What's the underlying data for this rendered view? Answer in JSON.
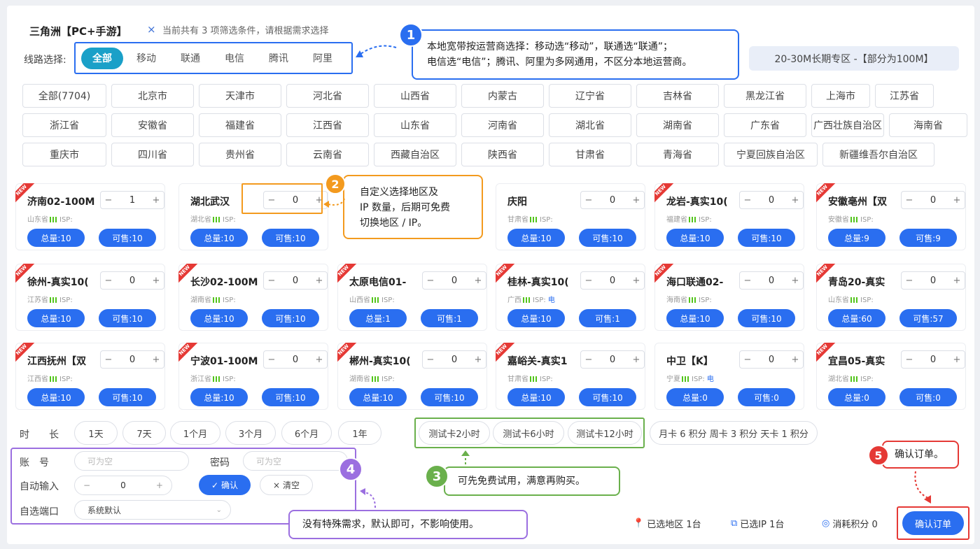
{
  "header": {
    "title": "三角洲【PC+手游】",
    "close": "×",
    "filter_tip": "当前共有 3 项筛选条件，请根据需求选择"
  },
  "line": {
    "label": "线路选择:",
    "options": [
      "全部",
      "移动",
      "联通",
      "电信",
      "腾讯",
      "阿里"
    ]
  },
  "zone": "20-30M长期专区 -【部分为100M】",
  "regions": {
    "row1": [
      "全部(7704)",
      "北京市",
      "天津市",
      "河北省",
      "山西省",
      "内蒙古",
      "辽宁省",
      "吉林省",
      "黑龙江省",
      "上海市",
      "江苏省"
    ],
    "row2": [
      "浙江省",
      "安徽省",
      "福建省",
      "江西省",
      "山东省",
      "河南省",
      "湖北省",
      "湖南省",
      "广东省",
      "广西壮族自治区",
      "海南省"
    ],
    "row3": [
      "重庆市",
      "四川省",
      "贵州省",
      "云南省",
      "西藏自治区",
      "陕西省",
      "甘肃省",
      "青海省",
      "宁夏回族自治区",
      "新疆维吾尔自治区"
    ]
  },
  "common": {
    "minus": "−",
    "plus": "+",
    "isp": "ISP:",
    "new": "NEW"
  },
  "cards": [
    {
      "name": "济南02-100M",
      "qty": "1",
      "prov": "山东省",
      "isp": "",
      "total": "总量:10",
      "sale": "可售:10",
      "is_new": true
    },
    {
      "name": "湖北武汉",
      "qty": "0",
      "prov": "湖北省",
      "isp": "",
      "total": "总量:10",
      "sale": "可售:10",
      "is_new": false
    },
    {
      "name": "庆阳",
      "qty": "0",
      "prov": "甘肃省",
      "isp": "",
      "total": "总量:10",
      "sale": "可售:10",
      "is_new": false
    },
    {
      "name": "龙岩-真实10(",
      "qty": "0",
      "prov": "福建省",
      "isp": "",
      "total": "总量:10",
      "sale": "可售:10",
      "is_new": true
    },
    {
      "name": "安徽亳州【双",
      "qty": "0",
      "prov": "安徽省",
      "isp": "",
      "total": "总量:9",
      "sale": "可售:9",
      "is_new": true
    },
    {
      "name": "徐州-真实10(",
      "qty": "0",
      "prov": "江苏省",
      "isp": "",
      "total": "总量:10",
      "sale": "可售:10",
      "is_new": true
    },
    {
      "name": "长沙02-100M",
      "qty": "0",
      "prov": "湖南省",
      "isp": "",
      "total": "总量:10",
      "sale": "可售:10",
      "is_new": true
    },
    {
      "name": "太原电信01-",
      "qty": "0",
      "prov": "山西省",
      "isp": "",
      "total": "总量:1",
      "sale": "可售:1",
      "is_new": true
    },
    {
      "name": "桂林-真实10(",
      "qty": "0",
      "prov": "广西",
      "isp": "电",
      "total": "总量:10",
      "sale": "可售:1",
      "is_new": true
    },
    {
      "name": "海口联通02-",
      "qty": "0",
      "prov": "海南省",
      "isp": "",
      "total": "总量:10",
      "sale": "可售:10",
      "is_new": true
    },
    {
      "name": "青岛20-真实",
      "qty": "0",
      "prov": "山东省",
      "isp": "",
      "total": "总量:60",
      "sale": "可售:57",
      "is_new": true
    },
    {
      "name": "江西抚州【双",
      "qty": "0",
      "prov": "江西省",
      "isp": "",
      "total": "总量:10",
      "sale": "可售:10",
      "is_new": true
    },
    {
      "name": "宁波01-100M",
      "qty": "0",
      "prov": "浙江省",
      "isp": "",
      "total": "总量:10",
      "sale": "可售:10",
      "is_new": true
    },
    {
      "name": "郴州-真实10(",
      "qty": "0",
      "prov": "湖南省",
      "isp": "",
      "total": "总量:10",
      "sale": "可售:10",
      "is_new": true
    },
    {
      "name": "嘉峪关-真实1",
      "qty": "0",
      "prov": "甘肃省",
      "isp": "",
      "total": "总量:10",
      "sale": "可售:10",
      "is_new": true
    },
    {
      "name": "中卫【K】",
      "qty": "0",
      "prov": "宁夏",
      "isp": "电",
      "total": "总量:0",
      "sale": "可售:0",
      "is_new": false
    },
    {
      "name": "宜昌05-真实",
      "qty": "0",
      "prov": "湖北省",
      "isp": "",
      "total": "总量:0",
      "sale": "可售:0",
      "is_new": true
    }
  ],
  "callouts": {
    "c1": {
      "num": "1",
      "line1": "本地宽带按运营商选择：移动选“移动”，联通选“联通”；",
      "line2": "电信选“电信”；腾讯、阿里为多网通用，不区分本地运营商。"
    },
    "c2": {
      "num": "2",
      "line1": "自定义选择地区及",
      "line2": "IP 数量，后期可免费",
      "line3": "切换地区 / IP。"
    },
    "c3": {
      "num": "3",
      "text": "可先免费试用，满意再购买。"
    },
    "c4": {
      "num": "4",
      "text": "没有特殊需求，默认即可，不影响使用。"
    },
    "c5": {
      "num": "5",
      "text": "确认订单。"
    }
  },
  "duration": {
    "label": "时长",
    "options": [
      "1天",
      "7天",
      "1个月",
      "3个月",
      "6个月",
      "1年"
    ],
    "trials": [
      "测试卡2小时",
      "测试卡6小时",
      "测试卡12小时"
    ],
    "points": "月卡 6 积分 周卡 3 积分 天卡 1 积分"
  },
  "form": {
    "account_label": "账　号",
    "account_ph": "可为空",
    "password_label": "密码",
    "password_ph": "可为空",
    "auto_label": "自动输入",
    "auto_val": "0",
    "confirm": "确认",
    "clear": "清空",
    "port_label": "自选端口",
    "port_val": "系统默认"
  },
  "summary": {
    "regions": "已选地区 1台",
    "ips": "已选IP 1台",
    "points": "消耗积分 0",
    "order_btn": "确认订单"
  },
  "colors": {
    "primary": "#2a6ef0",
    "teal": "#1aa0c8",
    "orange": "#f39a1e",
    "green": "#6ab04c",
    "purple": "#9b6fe0",
    "red": "#e53935"
  }
}
